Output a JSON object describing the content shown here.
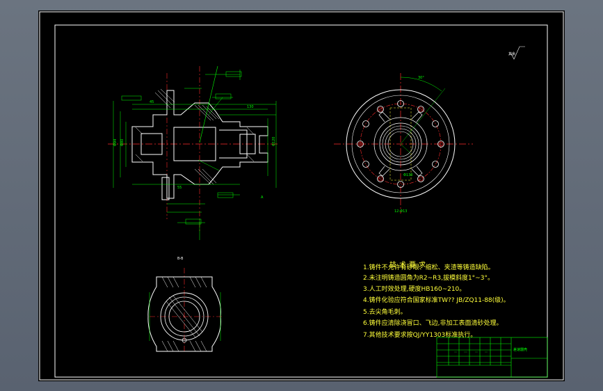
{
  "drawing": {
    "technical_requirements_title": "技术要求",
    "technical_requirements": [
      "1.铸件不允许有砂眼、缩松、夹渣等铸造缺陷。",
      "2.未注明铸造圆角为R2~R3,拔模斜度1°~3°。",
      "3.人工时效处理,硬度HB160~210。",
      "4.铸件化验应符合国家标准TW?? JB/ZQ11-88(级)。",
      "5.去尖角毛刺。",
      "6.铸件应清除浇冒口、飞边,非加工表面清砂处理。",
      "7.其他技术要求按QJ/YY1303标准执行。"
    ],
    "section_label": "B-B",
    "roughness_note": "其余",
    "title_block_name": "差速器壳"
  },
  "colors": {
    "sheet": "#000000",
    "frame": "#ffffff",
    "object_line": "#ffffff",
    "dimension": "#00ff00",
    "center_line": "#ff2a2a",
    "hidden_line": "#ffff3a",
    "text": "#ffff3a",
    "title_block": "#00ff00"
  }
}
